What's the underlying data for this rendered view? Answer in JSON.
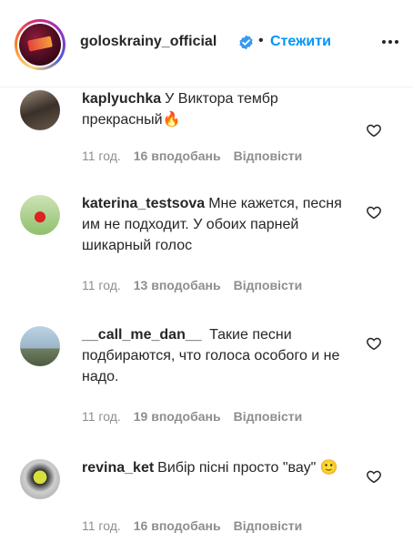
{
  "header": {
    "username": "goloskrainy_official",
    "separator": "•",
    "follow_label": "Стежити"
  },
  "comments": [
    {
      "username": "kaplyuchka",
      "text": "У Виктора тембр прекрасный",
      "emoji": "🔥",
      "time": "11 год.",
      "likes": "16 вподобань",
      "reply": "Відповісти"
    },
    {
      "username": "katerina_testsova",
      "text": "Мне кажется, песня им не подходит. У обоих парней шикарный голос",
      "emoji": "",
      "time": "11 год.",
      "likes": "13 вподобань",
      "reply": "Відповісти"
    },
    {
      "username": "__call_me_dan__",
      "text": " Такие песни подбираются, что голоса особого и не надо.",
      "emoji": "",
      "time": "11 год.",
      "likes": "19 вподобань",
      "reply": "Відповісти"
    },
    {
      "username": "revina_ket",
      "text": "Вибір пісні просто \"вау\"",
      "emoji": "🙂",
      "time": "11 год.",
      "likes": "16 вподобань",
      "reply": "Відповісти"
    }
  ],
  "colors": {
    "accent": "#0095f6",
    "muted": "#8e8e8e",
    "text": "#262626"
  }
}
